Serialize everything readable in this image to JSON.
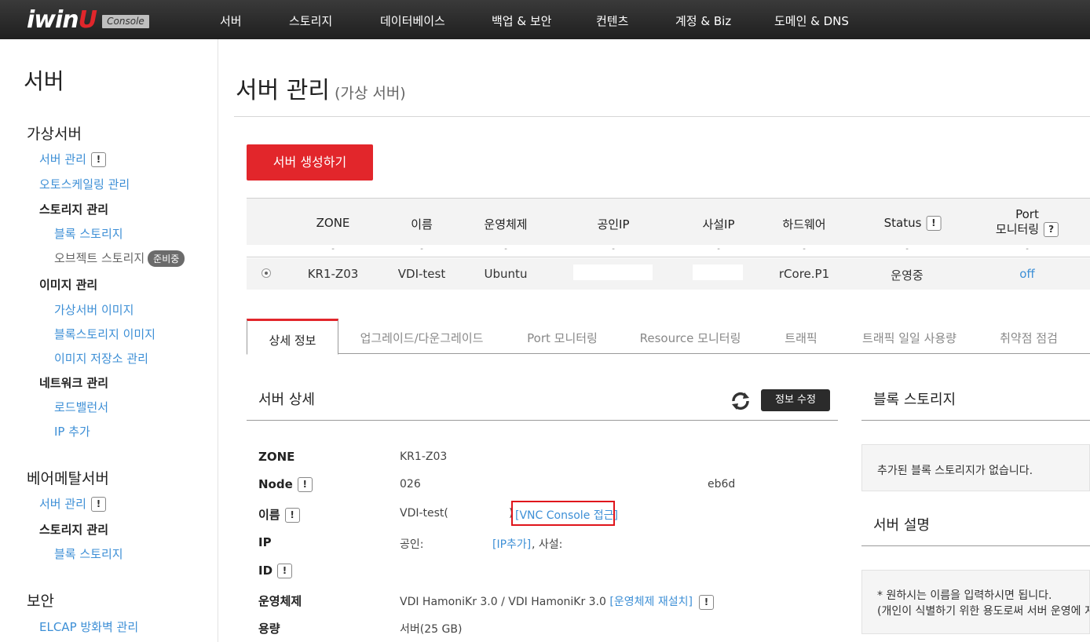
{
  "brand": {
    "name_pre": "iwin",
    "name_u": "U",
    "console": "Console"
  },
  "nav": [
    "서버",
    "스토리지",
    "데이터베이스",
    "백업 & 보안",
    "컨텐츠",
    "계정 & Biz",
    "도메인 & DNS"
  ],
  "sidebar": {
    "title": "서버",
    "virtual_heading": "가상서버",
    "server_mgmt": "서버 관리",
    "autoscaling": "오토스케일링 관리",
    "storage_mgmt": "스토리지 관리",
    "block_storage": "블록 스토리지",
    "object_storage": "오브젝트 스토리지",
    "preparing": "준비중",
    "image_mgmt": "이미지 관리",
    "vm_image": "가상서버 이미지",
    "block_image": "블록스토리지 이미지",
    "image_repo": "이미지 저장소 관리",
    "network_mgmt": "네트워크 관리",
    "load_balancer": "로드밸런서",
    "ip_add": "IP 추가",
    "baremetal_heading": "베어메탈서버",
    "bm_server_mgmt": "서버 관리",
    "bm_storage_mgmt": "스토리지 관리",
    "bm_block_storage": "블록 스토리지",
    "security_heading": "보안",
    "elcap": "ELCAP 방화벽 관리"
  },
  "page": {
    "title": "서버 관리",
    "subtitle": "(가상 서버)",
    "create_button": "서버 생성하기"
  },
  "table": {
    "headers": [
      "ZONE",
      "이름",
      "운영체제",
      "공인IP",
      "사설IP",
      "하드웨어",
      "Status",
      "Port",
      "모니터링"
    ],
    "dash": "-",
    "row": {
      "zone": "KR1-Z03",
      "name": "VDI-test",
      "os": "Ubuntu",
      "hardware": "rCore.P1",
      "status": "운영중",
      "port": "off"
    }
  },
  "tabs": [
    "상세 정보",
    "업그레이드/다운그레이드",
    "Port 모니터링",
    "Resource 모니터링",
    "트래픽",
    "트래픽 일일 사용량",
    "취약점 점검"
  ],
  "detail": {
    "title": "서버 상세",
    "edit_button": "정보 수정",
    "labels": [
      "ZONE",
      "Node",
      "이름",
      "IP",
      "ID",
      "운영체제",
      "용량"
    ],
    "zone": "KR1-Z03",
    "node": "026",
    "node_tail": "eb6d",
    "name": "VDI-test(",
    "name_close": ")",
    "vnc": "[VNC Console 접근]",
    "ip_public": "공인:",
    "ip_add": "[IP추가]",
    "ip_private": ", 사설:",
    "os": "VDI HamoniKr 3.0 / VDI HamoniKr 3.0",
    "os_reinstall": "[운영체제 재설치]",
    "capacity": "서버(25 GB)"
  },
  "block_storage": {
    "title": "블록 스토리지",
    "empty": "추가된 블록 스토리지가 없습니다."
  },
  "server_desc": {
    "title": "서버 설명",
    "line1": "* 원하시는 이름을 입력하시면 됩니다.",
    "line2": "(개인이 식별하기 위한 용도로써 서버 운영에 지장"
  },
  "colors": {
    "accent": "#e2262b",
    "link": "#3d8fd6",
    "nav_bg": "#2a2a2a"
  }
}
